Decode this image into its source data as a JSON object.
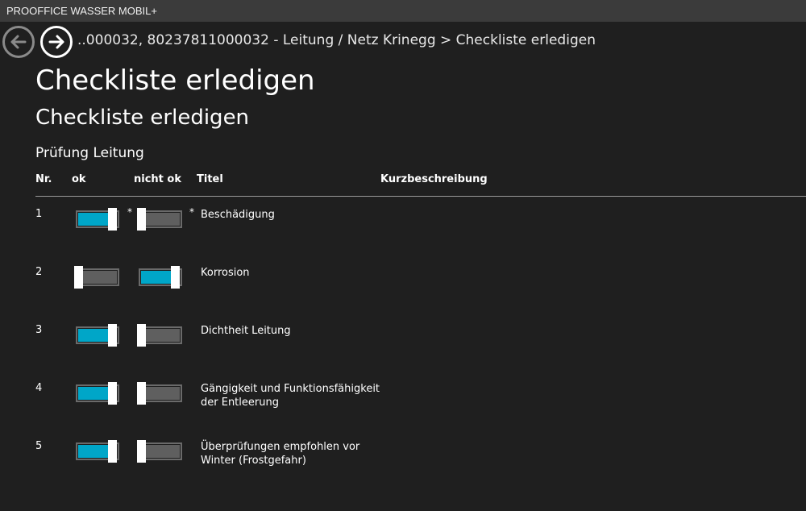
{
  "app": {
    "title": "PROOFFICE WASSER MOBIL+"
  },
  "nav": {
    "back_icon": "arrow-left-icon",
    "forward_icon": "arrow-right-icon",
    "breadcrumb": "..000032, 80237811000032 - Leitung / Netz Krinegg > Checkliste erledigen"
  },
  "page": {
    "title": "Checkliste erledigen",
    "subtitle": "Checkliste erledigen",
    "section": "Prüfung Leitung"
  },
  "table": {
    "headers": {
      "nr": "Nr.",
      "ok": "ok",
      "nicht_ok": "nicht ok",
      "titel": "Titel",
      "kurzbeschreibung": "Kurzbeschreibung"
    },
    "rows": [
      {
        "nr": "1",
        "ok": true,
        "nicht_ok": false,
        "title": "Beschädigung",
        "star_ok": "*",
        "star_nicht_ok": "*"
      },
      {
        "nr": "2",
        "ok": false,
        "nicht_ok": true,
        "title": "Korrosion"
      },
      {
        "nr": "3",
        "ok": true,
        "nicht_ok": false,
        "title": "Dichtheit Leitung"
      },
      {
        "nr": "4",
        "ok": true,
        "nicht_ok": false,
        "title": "Gängigkeit und Funktionsfähigkeit der Entleerung"
      },
      {
        "nr": "5",
        "ok": true,
        "nicht_ok": false,
        "title": "Überprüfungen empfohlen vor Winter (Frostgefahr)"
      }
    ]
  },
  "colors": {
    "accent": "#00a6c8",
    "off": "#5f5f5f",
    "background": "#1f1f1f",
    "titlebar": "#3b3b3b"
  }
}
